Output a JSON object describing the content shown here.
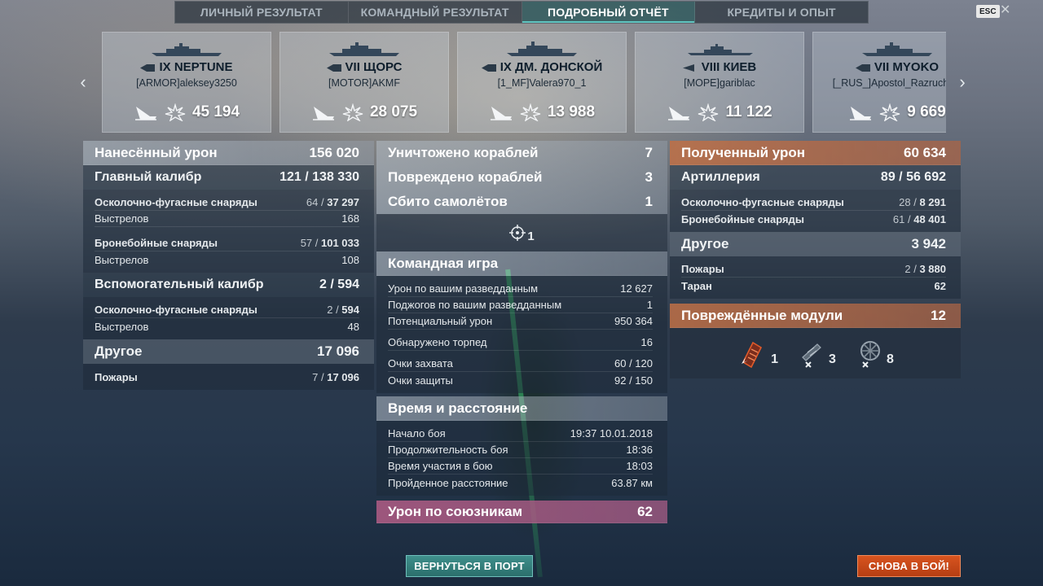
{
  "tabs": [
    {
      "label": "ЛИЧНЫЙ РЕЗУЛЬТАТ"
    },
    {
      "label": "КОМАНДНЫЙ РЕЗУЛЬТАТ"
    },
    {
      "label": "ПОДРОБНЫЙ ОТЧЁТ"
    },
    {
      "label": "КРЕДИТЫ И ОПЫТ"
    }
  ],
  "active_tab": "ПОДРОБНЫЙ ОТЧЁТ",
  "esc_label": "ESC",
  "close_glyph": "✕",
  "nav": {
    "prev": "‹",
    "next": "›"
  },
  "ships": [
    {
      "name": "IX NEPTUNE",
      "player": "[ARMOR]aleksey3250",
      "damage": "45 194",
      "icon": "cruiser-icon"
    },
    {
      "name": "VII ЩОРС",
      "player": "[MOTOR]AKMF",
      "damage": "28 075",
      "icon": "cruiser-icon"
    },
    {
      "name": "IX ДМ. ДОНСКОЙ",
      "player": "[1_MF]Valera970_1",
      "damage": "13 988",
      "icon": "cruiser-icon"
    },
    {
      "name": "VIII КИЕВ",
      "player": "[MOPE]gariblac",
      "damage": "11 122",
      "icon": "destroyer-icon"
    },
    {
      "name": "VII MYOKO",
      "player": "[_RUS_]Apostol_Razruchitel",
      "damage": "9 669",
      "icon": "cruiser-icon"
    }
  ],
  "left": {
    "dealt": {
      "label": "Нанесённый урон",
      "value": "156 020"
    },
    "main": {
      "label": "Главный калибр",
      "hits": "121",
      "value": "138 330"
    },
    "main_rows": [
      {
        "label": "Осколочно-фугасные снаряды",
        "hits": "64",
        "value": "37 297"
      },
      {
        "label": "Выстрелов",
        "value": "168"
      },
      {
        "label": "Бронебойные снаряды",
        "hits": "57",
        "value": "101 033"
      },
      {
        "label": "Выстрелов",
        "value": "108"
      }
    ],
    "secondary": {
      "label": "Вспомогательный калибр",
      "hits": "2",
      "value": "594"
    },
    "secondary_rows": [
      {
        "label": "Осколочно-фугасные снаряды",
        "hits": "2",
        "value": "594"
      },
      {
        "label": "Выстрелов",
        "value": "48"
      }
    ],
    "other": {
      "label": "Другое",
      "value": "17 096"
    },
    "other_rows": [
      {
        "label": "Пожары",
        "hits": "7",
        "value": "17 096"
      }
    ]
  },
  "mid": {
    "destroyed": {
      "label": "Уничтожено кораблей",
      "value": "7"
    },
    "damaged": {
      "label": "Повреждено кораблей",
      "value": "3"
    },
    "planes": {
      "label": "Сбито самолётов",
      "value": "1"
    },
    "crosshair_count": "1",
    "team": {
      "label": "Командная игра"
    },
    "team_rows": [
      {
        "label": "Урон по вашим разведданным",
        "value": "12 627"
      },
      {
        "label": "Поджогов по вашим разведданным",
        "value": "1"
      },
      {
        "label": "Потенциальный урон",
        "value": "950 364"
      },
      {
        "label": "Обнаружено торпед",
        "value": "16"
      },
      {
        "label": "Очки захвата",
        "value": "60 / 120"
      },
      {
        "label": "Очки защиты",
        "value": "92 / 150"
      }
    ],
    "time": {
      "label": "Время и расстояние"
    },
    "time_rows": [
      {
        "label": "Начало боя",
        "value": "19:37  10.01.2018"
      },
      {
        "label": "Продолжительность боя",
        "value": "18:36"
      },
      {
        "label": "Время участия в бою",
        "value": "18:03"
      },
      {
        "label": "Пройденное расстояние",
        "value": "63.87 км"
      }
    ],
    "allies": {
      "label": "Урон по союзникам",
      "value": "62"
    }
  },
  "right": {
    "received": {
      "label": "Полученный урон",
      "value": "60 634"
    },
    "artillery": {
      "label": "Артиллерия",
      "hits": "89",
      "value": "56 692"
    },
    "artillery_rows": [
      {
        "label": "Осколочно-фугасные снаряды",
        "hits": "28",
        "value": "8 291"
      },
      {
        "label": "Бронебойные снаряды",
        "hits": "61",
        "value": "48 401"
      }
    ],
    "other": {
      "label": "Другое",
      "value": "3 942"
    },
    "other_rows": [
      {
        "label": "Пожары",
        "hits": "2",
        "value": "3 880"
      },
      {
        "label": "Таран",
        "value": "62"
      }
    ],
    "modules": {
      "label": "Повреждённые модули",
      "value": "12"
    },
    "module_icons": [
      {
        "icon": "engine-module-icon",
        "count": "1"
      },
      {
        "icon": "turret-module-icon",
        "count": "3"
      },
      {
        "icon": "steering-module-icon",
        "count": "8"
      }
    ]
  },
  "buttons": {
    "port": "ВЕРНУТЬСЯ В ПОРТ",
    "battle": "СНОВА В БОЙ!"
  },
  "colors": {
    "accent_teal": "#3f8f8b",
    "accent_orange": "#d8541f",
    "received_orange": "#c07046",
    "allies_pink": "#aa5a82"
  }
}
